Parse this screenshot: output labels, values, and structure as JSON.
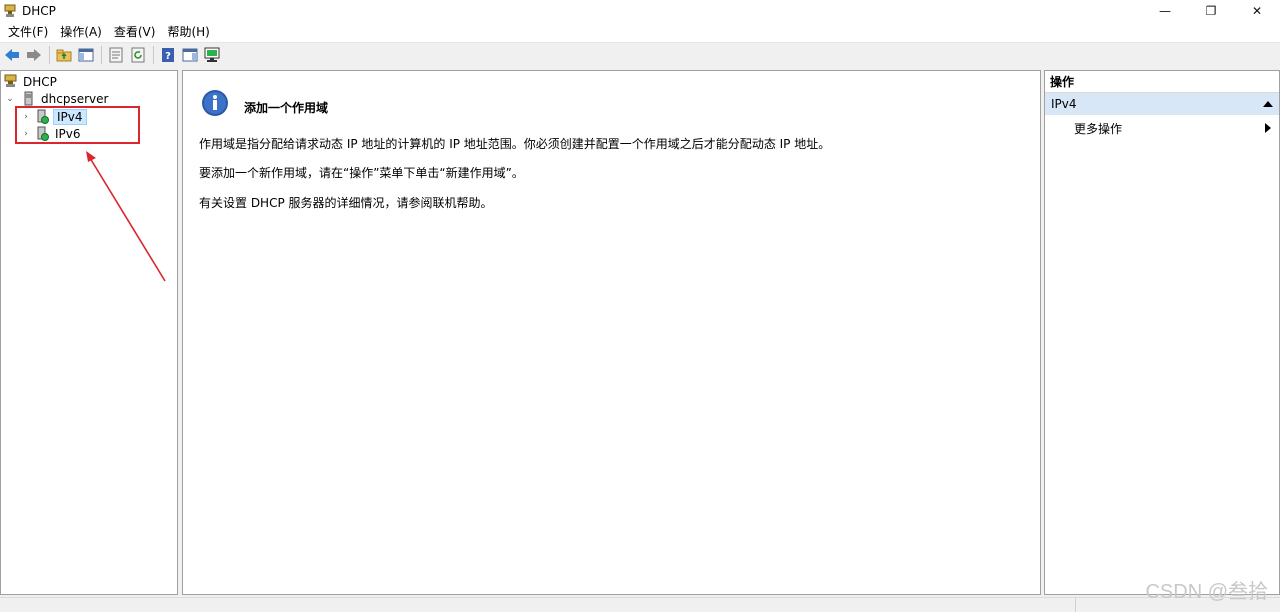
{
  "window": {
    "title": "DHCP",
    "controls": {
      "minimize": "—",
      "restore": "❐",
      "close": "✕"
    }
  },
  "menu": [
    "文件(F)",
    "操作(A)",
    "查看(V)",
    "帮助(H)"
  ],
  "toolbar": {
    "icons": [
      "back-icon",
      "forward-icon",
      "up-folder-icon",
      "show-hide-tree-icon",
      "properties-icon",
      "refresh-icon",
      "help-icon",
      "show-hide-action-icon",
      "server-monitor-icon"
    ]
  },
  "tree": {
    "root": "DHCP",
    "server": "dhcpserver",
    "children": [
      "IPv4",
      "IPv6"
    ],
    "expander_collapsed": "›",
    "expander_expanded": "⌄"
  },
  "content": {
    "title": "添加一个作用域",
    "paragraphs": [
      "作用域是指分配给请求动态 IP 地址的计算机的 IP 地址范围。你必须创建并配置一个作用域之后才能分配动态 IP 地址。",
      "要添加一个新作用域，请在“操作”菜单下单击“新建作用域”。",
      "有关设置 DHCP 服务器的详细情况，请参阅联机帮助。"
    ]
  },
  "actions": {
    "header": "操作",
    "section": "IPv4",
    "items": [
      "更多操作"
    ]
  },
  "watermark": "CSDN @叁拾",
  "colors": {
    "annotation_red": "#d9272d",
    "selection_blue": "#cce8ff",
    "actions_section": "#d7e7f7"
  }
}
